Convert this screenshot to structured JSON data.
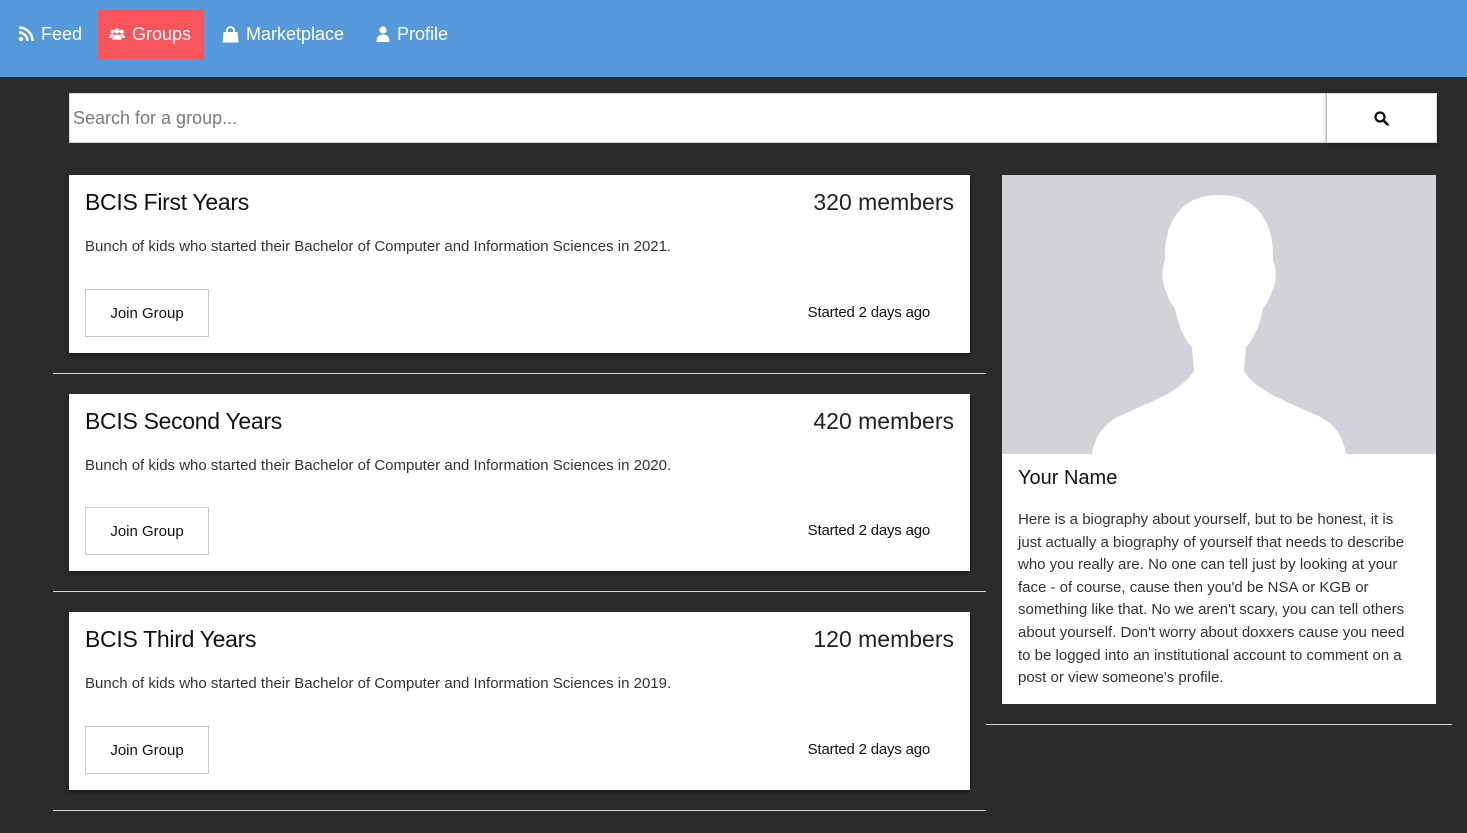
{
  "nav": {
    "items": [
      {
        "label": "Feed",
        "icon": "rss-icon"
      },
      {
        "label": "Groups",
        "icon": "users-icon",
        "active": true
      },
      {
        "label": "Marketplace",
        "icon": "shopping-bag-icon"
      },
      {
        "label": "Profile",
        "icon": "user-icon"
      }
    ],
    "colors": {
      "bar": "#5599db",
      "active": "#f8545c"
    }
  },
  "search": {
    "placeholder": "Search for a group...",
    "value": "",
    "button_icon": "search-icon"
  },
  "groups": [
    {
      "title": "BCIS First Years",
      "members": "320 members",
      "description": "Bunch of kids who started their Bachelor of Computer and Information Sciences in 2021.",
      "join_label": "Join Group",
      "started": "Started 2 days ago"
    },
    {
      "title": "BCIS Second Years",
      "members": "420 members",
      "description": "Bunch of kids who started their Bachelor of Computer and Information Sciences in 2020.",
      "join_label": "Join Group",
      "started": "Started 2 days ago"
    },
    {
      "title": "BCIS Third Years",
      "members": "120 members",
      "description": "Bunch of kids who started their Bachelor of Computer and Information Sciences in 2019.",
      "join_label": "Join Group",
      "started": "Started 2 days ago"
    }
  ],
  "profile": {
    "avatar_icon": "person-silhouette-icon",
    "name": "Your Name",
    "bio": "Here is a biography about yourself, but to be honest, it is just actually a biography of yourself that needs to describe who you really are. No one can tell just by looking at your face - of course, cause then you'd be NSA or KGB or something like that. No we aren't scary, you can tell others about yourself. Don't worry about doxxers cause you need to be logged into an institutional account to comment on a post or view someone's profile."
  }
}
